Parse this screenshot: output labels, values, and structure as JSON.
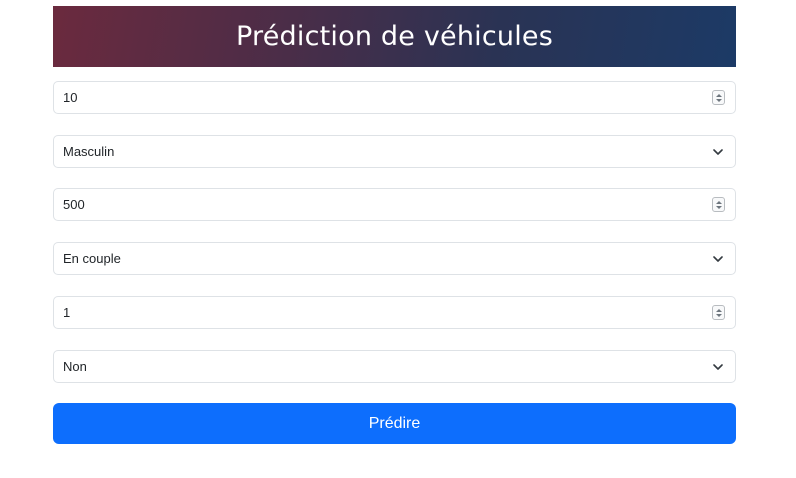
{
  "header": {
    "title": "Prédiction de véhicules"
  },
  "form": {
    "fields": [
      {
        "type": "number",
        "value": "10"
      },
      {
        "type": "select",
        "value": "Masculin"
      },
      {
        "type": "number",
        "value": "500"
      },
      {
        "type": "select",
        "value": "En couple"
      },
      {
        "type": "number",
        "value": "1"
      },
      {
        "type": "select",
        "value": "Non"
      }
    ],
    "submit_label": "Prédire"
  },
  "colors": {
    "accent": "#0d6efd",
    "banner_start": "#6b2a3e",
    "banner_end": "#1c3a66",
    "border": "#dee2e6"
  },
  "icons": {
    "number_spinner": "spinner-icon",
    "select_chevron": "chevron-down-icon"
  }
}
